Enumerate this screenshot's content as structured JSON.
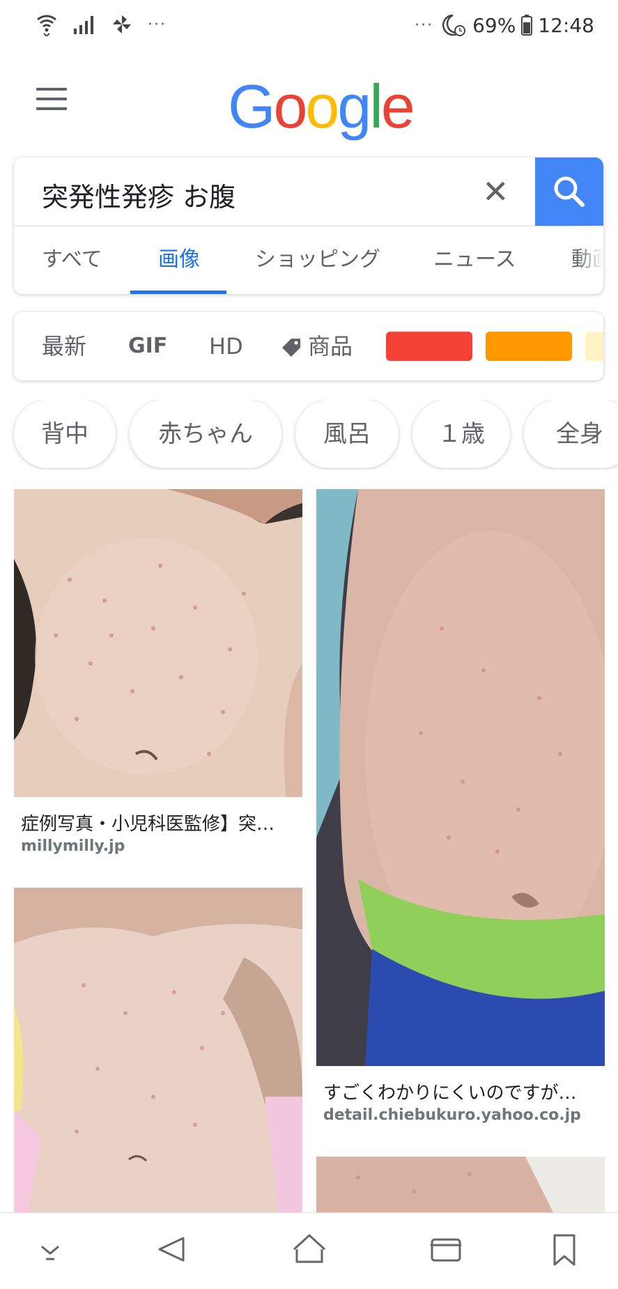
{
  "status_bar": {
    "battery": "69%",
    "time": "12:48",
    "dots_left": "···",
    "dots_right": "···",
    "icons": [
      "wifi-icon",
      "signal-icon",
      "pinwheel-icon",
      "moon-clock-icon",
      "battery-icon"
    ]
  },
  "header": {
    "logo_letters": [
      "G",
      "o",
      "o",
      "g",
      "l",
      "e"
    ],
    "menu_icon": "hamburger-menu-icon"
  },
  "search": {
    "query": "突発性発疹 お腹",
    "clear_icon": "close-icon",
    "button_icon": "search-icon",
    "accent": "#4285f4"
  },
  "tabs": [
    {
      "label": "すべて"
    },
    {
      "label": "画像",
      "active": true
    },
    {
      "label": "ショッピング"
    },
    {
      "label": "ニュース"
    },
    {
      "label": "動画"
    }
  ],
  "filters": {
    "newest": "最新",
    "gif": "GIF",
    "hd": "HD",
    "products": "商品",
    "product_icon": "tag-icon",
    "colors": [
      "#f44336",
      "#ff9800",
      "#fff3c4"
    ]
  },
  "chips": [
    "背中",
    "赤ちゃん",
    "風呂",
    "１歳",
    "全身"
  ],
  "results": [
    {
      "caption": "症例写真・小児科医監修】突…",
      "source": "millymilly.jp"
    },
    {
      "caption": "すごくわかりにくいのですが…",
      "source": "detail.chiebukuro.yahoo.co.jp"
    }
  ],
  "nav_bar": {
    "icons": [
      "chevron-down-icon",
      "back-icon",
      "home-icon",
      "recent-apps-icon",
      "bookmark-icon"
    ]
  }
}
